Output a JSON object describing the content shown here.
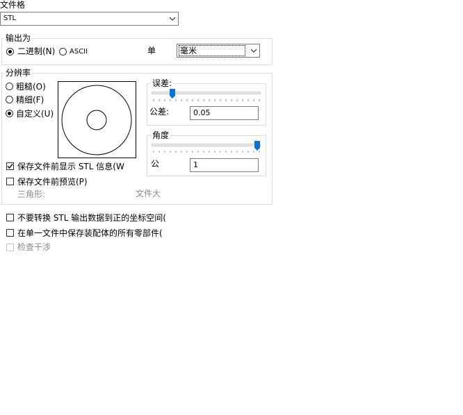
{
  "file_format": {
    "label": "文件格",
    "value": "STL"
  },
  "output_group": {
    "title": "输出为",
    "binary_label": "二进制(N)",
    "ascii_label": "ASCII",
    "unit_label": "单",
    "unit_value": "毫米"
  },
  "resolution_group": {
    "title": "分辨率",
    "coarse_label": "粗糙(O)",
    "fine_label": "精细(F)",
    "custom_label": "自定义(U)",
    "selected": "custom",
    "show_info_label": "保存文件前显示 STL 信息(W",
    "show_info_checked": true,
    "preview_label": "保存文件前预览(P)",
    "preview_checked": false,
    "triangles_label": "三角形:",
    "file_size_label": "文件大"
  },
  "deviation": {
    "title": "误差:",
    "tolerance_label": "公差:",
    "tolerance_value": "0.05",
    "slider_level": 0.2
  },
  "angle": {
    "title": "角度",
    "tolerance_label": "公",
    "tolerance_value": "1",
    "slider_level": 0.98
  },
  "options": {
    "no_transform_label": "不要转换 STL 输出数据到正的坐标空间(",
    "single_file_label": "在单一文件中保存装配体的所有零部件(",
    "check_interference_label": "检查干涉"
  }
}
